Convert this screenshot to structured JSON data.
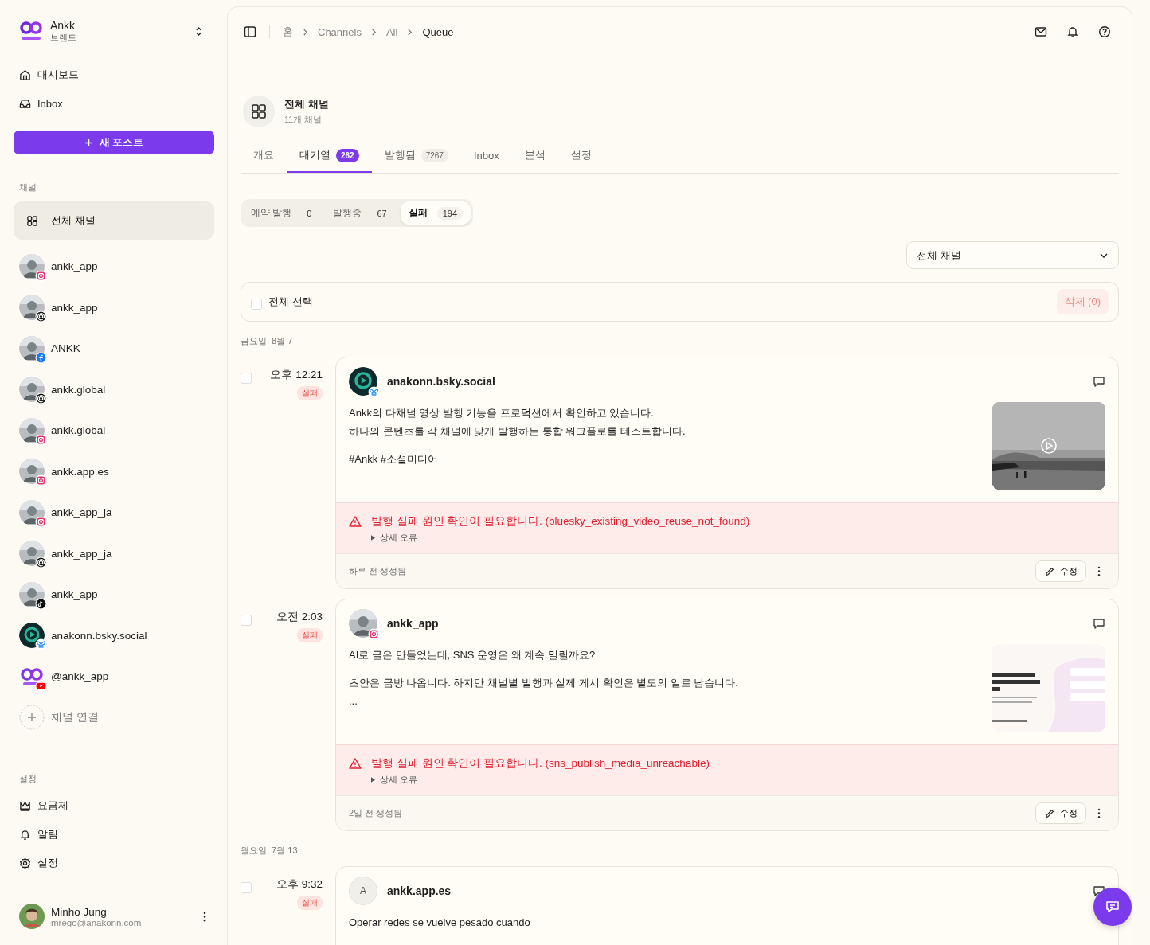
{
  "brand": {
    "name": "Ankk",
    "subtitle": "브랜드"
  },
  "nav": [
    {
      "label": "대시보드",
      "kind": "home"
    },
    {
      "label": "Inbox",
      "kind": "inbox"
    }
  ],
  "new_post_button": "새 포스트",
  "channels_heading": "채널",
  "all_channels": {
    "label": "전체 채널",
    "selected": true
  },
  "channels": [
    {
      "name": "ankk_app",
      "kind": "instagram"
    },
    {
      "name": "ankk_app",
      "kind": "threads"
    },
    {
      "name": "ANKK",
      "kind": "facebook"
    },
    {
      "name": "ankk.global",
      "kind": "threads"
    },
    {
      "name": "ankk.global",
      "kind": "instagram"
    },
    {
      "name": "ankk.app.es",
      "kind": "instagram"
    },
    {
      "name": "ankk_app_ja",
      "kind": "instagram"
    },
    {
      "name": "ankk_app_ja",
      "kind": "threads"
    },
    {
      "name": "ankk_app",
      "kind": "tiktok"
    },
    {
      "name": "anakonn.bsky.social",
      "kind": "bluesky"
    },
    {
      "name": "@ankk_app",
      "kind": "youtube"
    }
  ],
  "connect_channel": "채널 연결",
  "settings_heading": "설정",
  "settings_items": [
    {
      "label": "요금제",
      "kind": "crown"
    },
    {
      "label": "알림",
      "kind": "bell"
    },
    {
      "label": "설정",
      "kind": "gear"
    }
  ],
  "user": {
    "name": "Minho Jung",
    "email": "mrego@anakonn.com"
  },
  "breadcrumb": [
    "홈",
    "Channels",
    "All",
    "Queue"
  ],
  "header": {
    "title": "전체 채널",
    "subtitle": "11개 채널"
  },
  "tabs": [
    {
      "label": "개요",
      "selected": false
    },
    {
      "label": "대기열",
      "count": "262",
      "selected": true
    },
    {
      "label": "발행됨",
      "count": "7267",
      "selected": false
    },
    {
      "label": "Inbox",
      "selected": false
    },
    {
      "label": "분석",
      "selected": false
    },
    {
      "label": "설정",
      "selected": false
    }
  ],
  "filters": [
    {
      "label": "예약 발행",
      "count": "0",
      "selected": false
    },
    {
      "label": "발행중",
      "count": "67",
      "selected": false
    },
    {
      "label": "실패",
      "count": "194",
      "selected": true
    }
  ],
  "channel_select": "전체 채널",
  "select_all": {
    "label": "전체 선택",
    "checked": false
  },
  "delete_button": {
    "label": "삭제 (0)",
    "disabled": true
  },
  "groups": [
    {
      "date": "금요일, 8월 7",
      "posts": [
        {
          "time": "오후 12:21",
          "status": "실패",
          "checked": false,
          "account": "anakonn.bsky.social",
          "kind": "bluesky",
          "paragraphs": [
            [
              "Ankk의 다채널 영상 발행 기능을 프로덕션에서 확인하고 있습니다.",
              "하나의 콘텐츠를 각 채널에 맞게 발행하는 통합 워크플로를 테스트합니다."
            ],
            [
              "#Ankk #소셜미디어"
            ]
          ],
          "media": {
            "kind": "video"
          },
          "error": "발행 실패 원인 확인이 필요합니다. (bluesky_existing_video_reuse_not_found)",
          "error_detail": "상세 오류",
          "created": "하루 전 생성됨",
          "edit": "수정"
        },
        {
          "time": "오전 2:03",
          "status": "실패",
          "checked": false,
          "account": "ankk_app",
          "kind": "instagram",
          "paragraphs": [
            [
              "AI로 글은 만들었는데, SNS 운영은 왜 계속 밀릴까요?"
            ],
            [
              "초안은 금방 나옵니다. 하지만 채널별 발행과 실제 게시 확인은 별도의 일로 남습니다.",
              "..."
            ]
          ],
          "media": {
            "kind": "picture"
          },
          "error": "발행 실패 원인 확인이 필요합니다. (sns_publish_media_unreachable)",
          "error_detail": "상세 오류",
          "created": "2일 전 생성됨",
          "edit": "수정"
        }
      ]
    },
    {
      "date": "월요일, 7월 13",
      "posts": [
        {
          "time": "오후 9:32",
          "status": "실패",
          "checked": false,
          "account": "ankk.app.es",
          "kind": "letter",
          "avatar_letter": "A",
          "paragraphs": [
            [
              "Operar redes se vuelve pesado cuando"
            ]
          ]
        }
      ]
    }
  ]
}
